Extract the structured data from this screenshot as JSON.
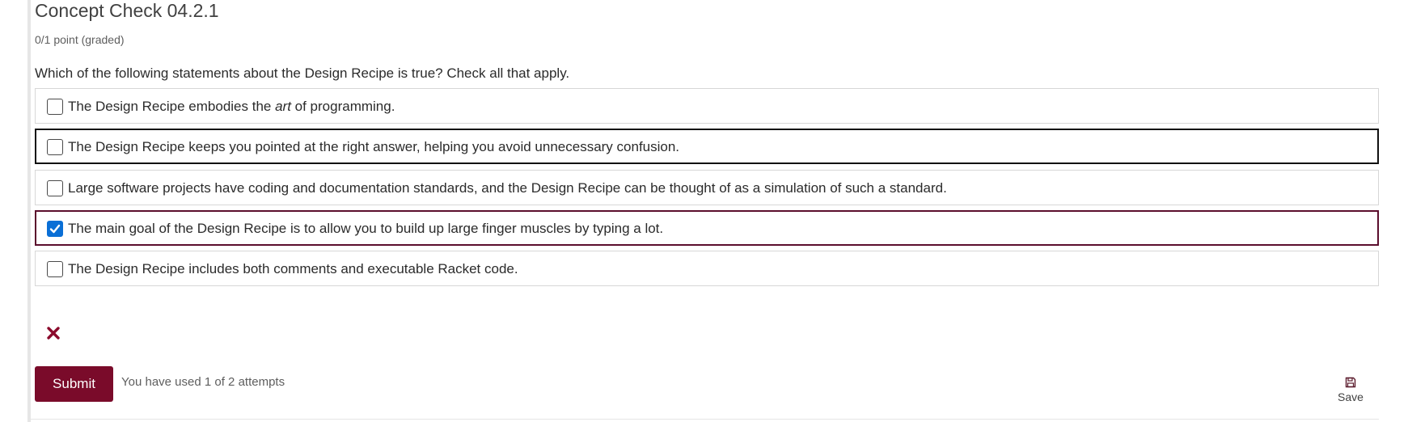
{
  "problem": {
    "title": "Concept Check 04.2.1",
    "points": "0/1 point (graded)",
    "question": "Which of the following statements about the Design Recipe is true? Check all that apply.",
    "choices": [
      {
        "prefix": "The Design Recipe embodies the ",
        "emphasis": "art",
        "suffix": " of programming.",
        "checked": false
      },
      {
        "text": "The Design Recipe keeps you pointed at the right answer, helping you avoid unnecessary confusion.",
        "checked": false
      },
      {
        "text": "Large software projects have coding and documentation standards, and the Design Recipe can be thought of as a simulation of such a standard.",
        "checked": false
      },
      {
        "text": "The main goal of the Design Recipe is to allow you to build up large finger muscles by typing a lot.",
        "checked": true
      },
      {
        "text": "The Design Recipe includes both comments and executable Racket code.",
        "checked": false
      }
    ],
    "status_icon": "incorrect-x-icon"
  },
  "actions": {
    "submit_label": "Submit",
    "attempts_text": "You have used 1 of 2 attempts",
    "save_label": "Save",
    "save_icon": "floppy-disk-icon"
  },
  "colors": {
    "brand": "#7a0b2a",
    "checkbox_checked": "#0a6fd6",
    "selected_border": "#5b0e2d",
    "incorrect_icon": "#8b0a2c"
  }
}
